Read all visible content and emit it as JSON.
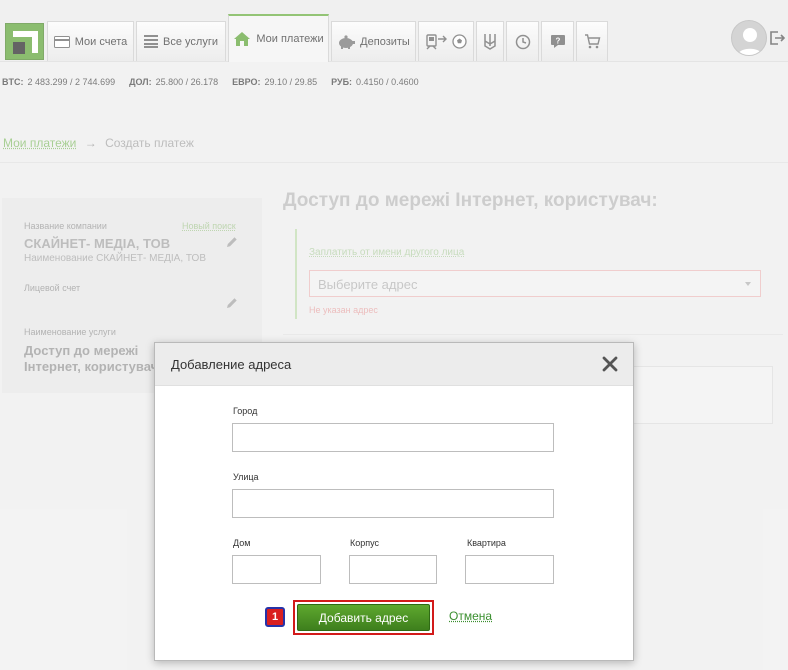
{
  "nav": {
    "tabs": [
      {
        "label": "Мои счета",
        "icon": "card-icon"
      },
      {
        "label": "Все услуги",
        "icon": "list-icon"
      },
      {
        "label": "Мои платежи",
        "icon": "home-icon"
      },
      {
        "label": "Депозиты",
        "icon": "piggy-bank-icon"
      }
    ],
    "active_tab": "Мои платежи",
    "icon_tabs": [
      "transport-icon",
      "football-icon",
      "trident-icon",
      "history-icon",
      "help-icon",
      "cart-icon"
    ]
  },
  "rates": [
    {
      "name": "BTC:",
      "value": "2 483.299 / 2 744.699"
    },
    {
      "name": "ДОЛ:",
      "value": "25.800 / 26.178"
    },
    {
      "name": "ЕВРО:",
      "value": "29.10 / 29.85"
    },
    {
      "name": "РУБ:",
      "value": "0.4150 / 0.4600"
    }
  ],
  "breadcrumb": {
    "parent": "Мои платежи",
    "arrow": "→",
    "current": "Создать платеж"
  },
  "left_panel": {
    "company_label": "Название компании",
    "new_search": "Новый поиск",
    "company_name": "СКАЙНЕТ- МЕДIА, ТОВ",
    "company_sub": "Наименование СКАЙНЕТ- МЕДIА, ТОВ",
    "account_label": "Лицевой счет",
    "service_label": "Наименование услуги",
    "service_name": "Доступ до мережi Інтернет, користувач:"
  },
  "form": {
    "heading": "Доступ до мережi Інтернет, користувач:",
    "pay_other": "Заплатить от имени другого лица",
    "address_placeholder": "Выберите адрес",
    "address_error": "Не указан адрес"
  },
  "modal": {
    "title": "Добавление адреса",
    "city_label": "Город",
    "street_label": "Улица",
    "house_label": "Дом",
    "building_label": "Корпус",
    "apartment_label": "Квартира",
    "add_button": "Добавить адрес",
    "cancel": "Отмена",
    "marker": "1"
  },
  "colors": {
    "brand_green": "#4e9a22",
    "button_green": "#4f9627",
    "highlight_red": "#d21a1a",
    "error": "#e29a9a"
  }
}
